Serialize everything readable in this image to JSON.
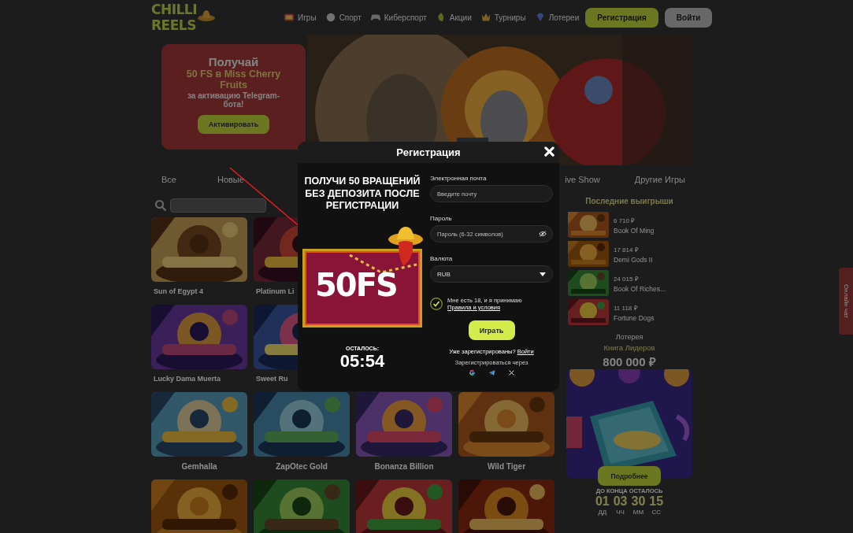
{
  "header": {
    "logo_lines": [
      "CHILLI",
      "REELS"
    ],
    "nav": [
      {
        "label": "Игры",
        "kind": "slots"
      },
      {
        "label": "Спорт",
        "kind": "sport"
      },
      {
        "label": "Киберспорт",
        "kind": "gamepad"
      },
      {
        "label": "Акции",
        "kind": "promo"
      },
      {
        "label": "Турниры",
        "kind": "trophy"
      },
      {
        "label": "Лотереи",
        "kind": "gem"
      }
    ],
    "register_button": "Регистрация",
    "login_button": "Войти"
  },
  "promo": {
    "title": "Получай",
    "highlight": "50 FS в Miss Cherry Fruits",
    "subtitle": "за активацию Telegram-бота!",
    "button": "Активировать"
  },
  "game_tabs": [
    {
      "label": "Все"
    },
    {
      "label": "Новые"
    },
    {
      "label": "ive Show"
    },
    {
      "label": "Другие Игры"
    }
  ],
  "game_rows": [
    [
      {
        "name": "Sun of Egypt 4"
      },
      {
        "name": "Platinum Li"
      }
    ],
    [
      {
        "name": "Lucky Dama Muerta"
      },
      {
        "name": "Sweet Ru"
      }
    ],
    [
      {
        "name": "Gemhalla"
      },
      {
        "name": "ZapOtec Gold"
      },
      {
        "name": "Bonanza Billion"
      },
      {
        "name": "Wild Tiger"
      }
    ],
    [
      {
        "kind": "picture"
      },
      {
        "kind": "picture"
      },
      {
        "kind": "picture"
      },
      {
        "kind": "picture"
      }
    ]
  ],
  "winners": {
    "title": "Последние выигрыши",
    "items": [
      {
        "amount": "6 710 ₽",
        "game": "Book Of Ming"
      },
      {
        "amount": "17 814 ₽",
        "game": "Demi Gods II"
      },
      {
        "amount": "24 015 ₽",
        "game": "Book Of Riches..."
      },
      {
        "amount": "11 118 ₽",
        "game": "Fortune Dogs"
      }
    ]
  },
  "lottery": {
    "label": "Лотерея",
    "name": "Книга Лидеров",
    "prize": "800 000 ₽",
    "button": "Подробнее",
    "countdown_label": "ДО КОНЦА ОСТАЛОСЬ",
    "countdown": [
      {
        "value": "01",
        "unit": "ДД"
      },
      {
        "value": "03",
        "unit": "ЧЧ"
      },
      {
        "value": "30",
        "unit": "ММ"
      },
      {
        "value": "15",
        "unit": "СС"
      }
    ]
  },
  "chat_tab": "Онлайн чат",
  "modal": {
    "title": "Регистрация",
    "headline": "ПОЛУЧИ 50 ВРАЩЕНИЙ БЕЗ ДЕПОЗИТА ПОСЛЕ РЕГИСТРАЦИИ",
    "banner_text": "50FS",
    "timer_label": "ОСТАЛОСЬ:",
    "timer": "05:54",
    "fields": [
      {
        "label": "Электронная почта",
        "placeholder": "Введите почту",
        "kind": "text"
      },
      {
        "label": "Пароль",
        "placeholder": "Пароль (6-32 символов)",
        "kind": "password"
      },
      {
        "label": "Валюта",
        "value": "RUB",
        "kind": "select"
      }
    ],
    "consent": {
      "text": "Мне есть 18, и я принимаю",
      "link": "Правила и условия",
      "checked": true
    },
    "submit": "Играть",
    "login_prompt": "Уже зарегистрированы?",
    "login_link": "Войти",
    "social_label": "Зарегистрироваться через",
    "social": [
      {
        "kind": "google"
      },
      {
        "kind": "telegram"
      },
      {
        "kind": "x"
      }
    ]
  }
}
